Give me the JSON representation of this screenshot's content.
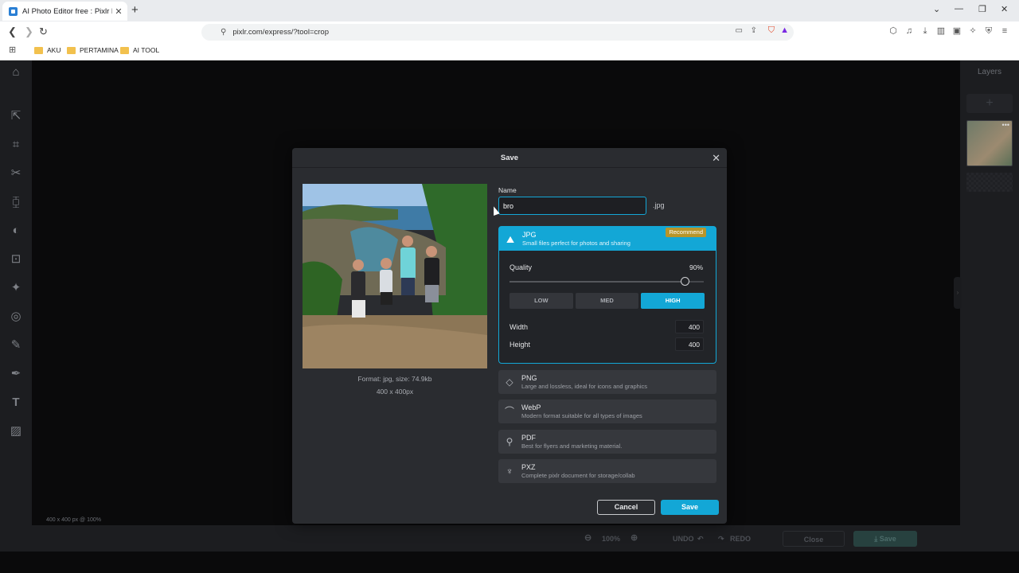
{
  "browser": {
    "tab_title": "AI Photo Editor free : Pixlr Expr",
    "tab_close": "✕",
    "new_tab": "+",
    "url": "pixlr.com/express/?tool=crop",
    "bookmarks": [
      "AKU",
      "PERTAMINA",
      "AI TOOL"
    ]
  },
  "app": {
    "canvas_info": "400 x 400 px @ 100%",
    "layers_title": "Layers",
    "zoom": "100%",
    "undo": "UNDO",
    "redo": "REDO",
    "close": "Close",
    "save": "Save"
  },
  "dialog": {
    "title": "Save",
    "preview_format": "Format: jpg, size: 74.9kb",
    "preview_dims": "400 x 400px",
    "name_label": "Name",
    "name_value": "bro",
    "extension": ".jpg",
    "jpg": {
      "name": "JPG",
      "desc": "Small files perfect for photos and sharing",
      "badge": "Recommend",
      "quality_label": "Quality",
      "quality_value": "90%",
      "quality_fraction": 0.9,
      "presets": [
        "LOW",
        "MED",
        "HIGH"
      ],
      "selected_preset": "HIGH",
      "width_label": "Width",
      "width_value": "400",
      "height_label": "Height",
      "height_value": "400"
    },
    "formats": [
      {
        "name": "PNG",
        "desc": "Large and lossless, ideal for icons and graphics"
      },
      {
        "name": "WebP",
        "desc": "Modern format suitable for all types of images"
      },
      {
        "name": "PDF",
        "desc": "Best for flyers and marketing material."
      },
      {
        "name": "PXZ",
        "desc": "Complete pixlr document for storage/collab"
      }
    ],
    "cancel": "Cancel",
    "save": "Save"
  },
  "colors": {
    "accent": "#13a7d6",
    "badge": "#b8952a",
    "dialog_bg": "#2a2c30"
  }
}
